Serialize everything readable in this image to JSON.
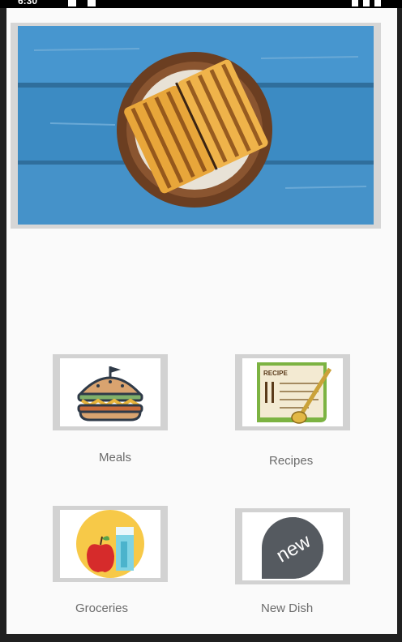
{
  "status_bar": {
    "time": "6:30"
  },
  "hero": {
    "image": "sandwich-plate-photo"
  },
  "menu": [
    {
      "id": "meals",
      "label": "Meals",
      "icon": "burger-icon"
    },
    {
      "id": "recipes",
      "label": "Recipes",
      "icon": "recipe-card-icon"
    },
    {
      "id": "groceries",
      "label": "Groceries",
      "icon": "groceries-icon"
    },
    {
      "id": "new-dish",
      "label": "New Dish",
      "icon": "new-badge-icon"
    }
  ],
  "colors": {
    "screen_bg": "#fafafa",
    "frame": "#d2d2d2",
    "label": "#6b6b6b",
    "table_blue": "#3f8fc7"
  }
}
